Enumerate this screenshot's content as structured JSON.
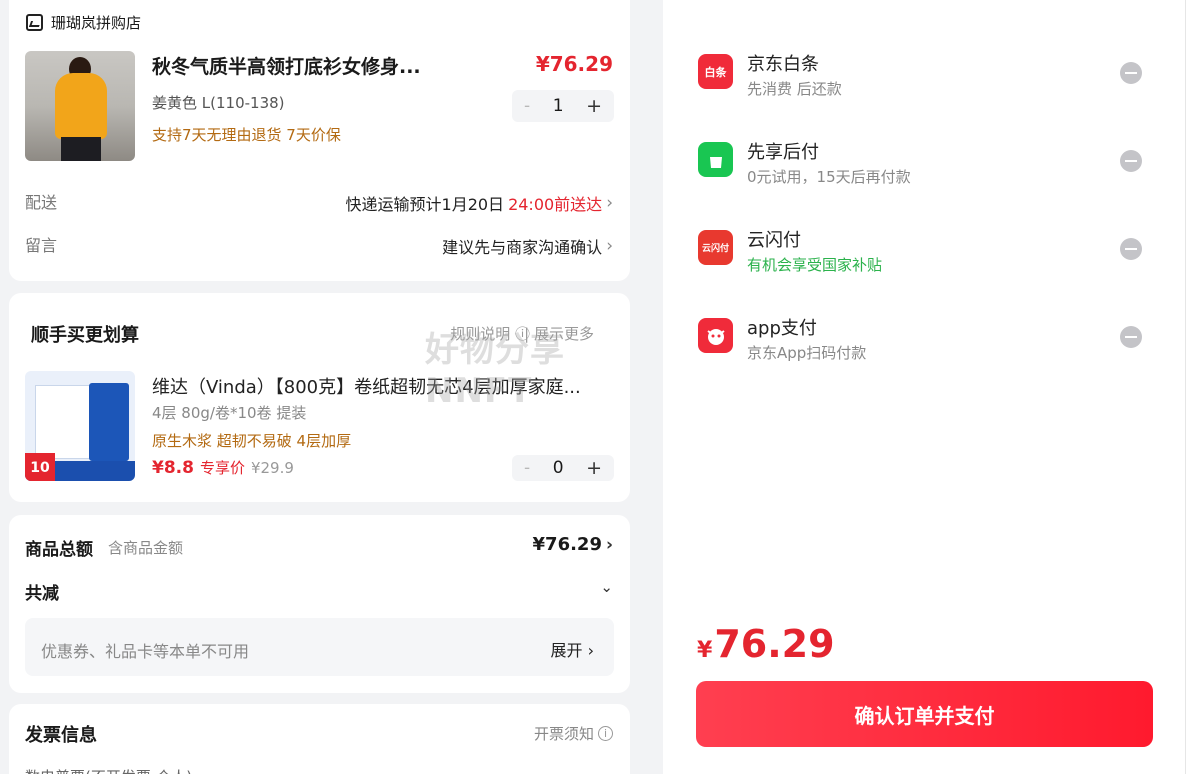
{
  "shop": {
    "name": "珊瑚岚拼购店"
  },
  "product": {
    "title": "秋冬气质半高领打底衫女修身...",
    "price": "¥76.29",
    "spec": "姜黄色  L(110-138)",
    "tags": "支持7天无理由退货  7天价保",
    "qty": "1"
  },
  "delivery": {
    "label": "配送",
    "value": "快递运输预计1月20日",
    "deadline": "24:00前送达"
  },
  "message": {
    "label": "留言",
    "value": "建议先与商家沟通确认"
  },
  "addon": {
    "title": "顺手买更划算",
    "rules": "规则说明 ⓘ",
    "more": "| 展示更多",
    "watermark": "好物分享NNFT"
  },
  "product2": {
    "title": "维达（Vinda）【800克】卷纸超韧无芯4层加厚家庭...",
    "spec": "4层 80g/卷*10卷 提装",
    "tags": "原生木浆 超韧不易破 4层加厚",
    "price": "¥8.8",
    "price_label": "专享价",
    "orig_price": "¥29.9",
    "qty": "0",
    "badge": "10"
  },
  "summary": {
    "total_label": "商品总额",
    "total_sub": "含商品金额",
    "total_value": "¥76.29",
    "reduce_label": "共减",
    "coupon_text": "优惠券、礼品卡等本单不可用",
    "expand": "展开"
  },
  "invoice": {
    "title": "发票信息",
    "notice": "开票须知",
    "row": "数电普票(不开发票-个人)"
  },
  "payments": [
    {
      "name": "京东白条",
      "desc": "先消费 后还款",
      "icon": "baitiao-icon",
      "icon_text": "白条",
      "color": "#f02b3a"
    },
    {
      "name": "先享后付",
      "desc": "0元试用，15天后再付款",
      "icon": "shopping-bag-icon",
      "icon_text": "",
      "color": "#19c652"
    },
    {
      "name": "云闪付",
      "desc": "有机会享受国家补贴",
      "icon": "unionpay-icon",
      "icon_text": "云闪付",
      "color": "#e8392f"
    },
    {
      "name": "app支付",
      "desc": "京东App扫码付款",
      "icon": "jd-dog-icon",
      "icon_text": "",
      "color": "#f02b3a"
    }
  ],
  "footer": {
    "currency": "¥",
    "amount": "76.29",
    "button": "确认订单并支付"
  }
}
